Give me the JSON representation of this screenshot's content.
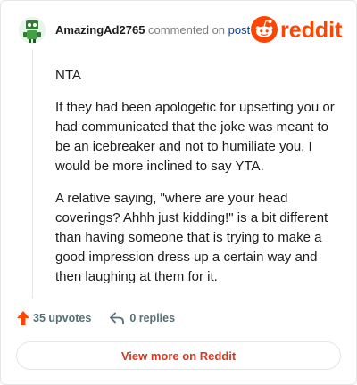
{
  "comment": {
    "username": "AmazingAd2765",
    "action_text": "commented on",
    "post_link": "post",
    "paragraphs": [
      "NTA",
      "If they had been apologetic for upsetting you or had communicated that the joke was meant to be an icebreaker and not to humiliate you, I would be more inclined to say YTA.",
      "A relative saying, \"where are your head coverings? Ahhh just kidding!\" is a bit different than having someone that is trying to make a good impression dress up a certain way and then laughing at them for it."
    ],
    "upvotes": "35 upvotes",
    "replies": "0 replies"
  },
  "brand": {
    "logo_text": "reddit",
    "accent": "#ff4500"
  },
  "footer": {
    "more_label": "View more on Reddit"
  },
  "icons": [
    "avatar",
    "reddit-logo-icon",
    "upvote-arrow-icon",
    "reply-arrow-icon"
  ]
}
